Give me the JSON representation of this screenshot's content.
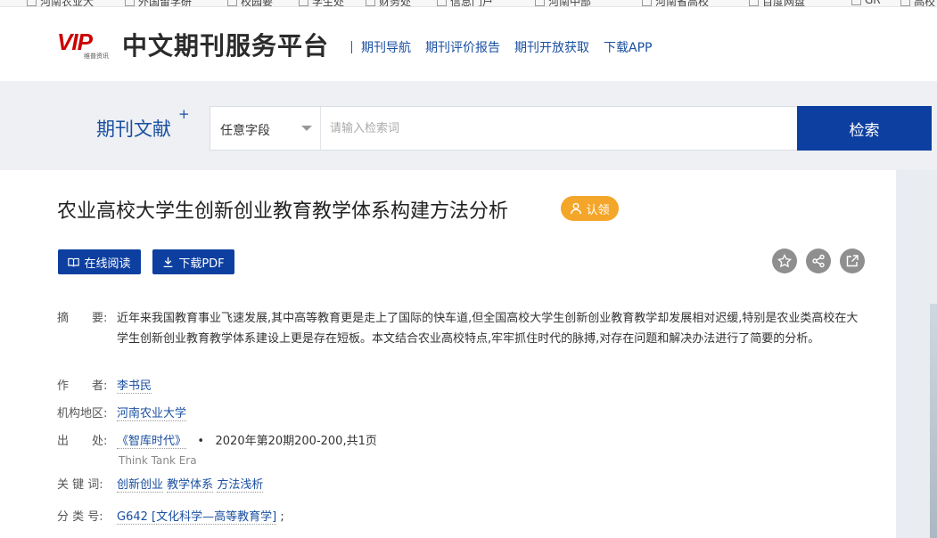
{
  "bookmarks": [
    "河南农业大",
    "外国留学研",
    "校园要",
    "学生处",
    "财务处",
    "信息门户",
    "河南中部",
    "河南省高校",
    "百度网盘",
    "GR",
    "高校"
  ],
  "header": {
    "logo_text": "VIP",
    "logo_sub": "维普资讯",
    "platform_title": "中文期刊服务平台",
    "nav": [
      "期刊导航",
      "期刊评价报告",
      "期刊开放获取",
      "下载APP"
    ]
  },
  "search": {
    "label": "期刊文献",
    "label_plus": "+",
    "field": "任意字段",
    "placeholder": "请输入检索词",
    "button": "检索"
  },
  "article": {
    "title": "农业高校大学生创新创业教育教学体系构建方法分析",
    "claim": "认领",
    "read_online": "在线阅读",
    "download_pdf": "下载PDF",
    "abstract_label": "摘　　要:",
    "abstract": "近年来我国教育事业飞速发展,其中高等教育更是走上了国际的快车道,但全国高校大学生创新创业教育教学却发展相对迟缓,特别是农业类高校在大学生创新创业教育教学体系建设上更是存在短板。本文结合农业高校特点,牢牢抓住时代的脉搏,对存在问题和解决办法进行了简要的分析。",
    "author_label": "作　　者:",
    "author": "李书民",
    "org_label": "机构地区:",
    "org": "河南农业大学",
    "source_label": "出　　处:",
    "journal": "《智库时代》",
    "issue": "2020年第20期200-200,共1页",
    "journal_en": "Think Tank Era",
    "keywords_label": "关 键 词:",
    "keywords": [
      "创新创业",
      "教学体系",
      "方法浅析"
    ],
    "class_label": "分 类 号:",
    "class_code": "G642 [文化科学—高等教育学]",
    "class_suffix": ";"
  }
}
